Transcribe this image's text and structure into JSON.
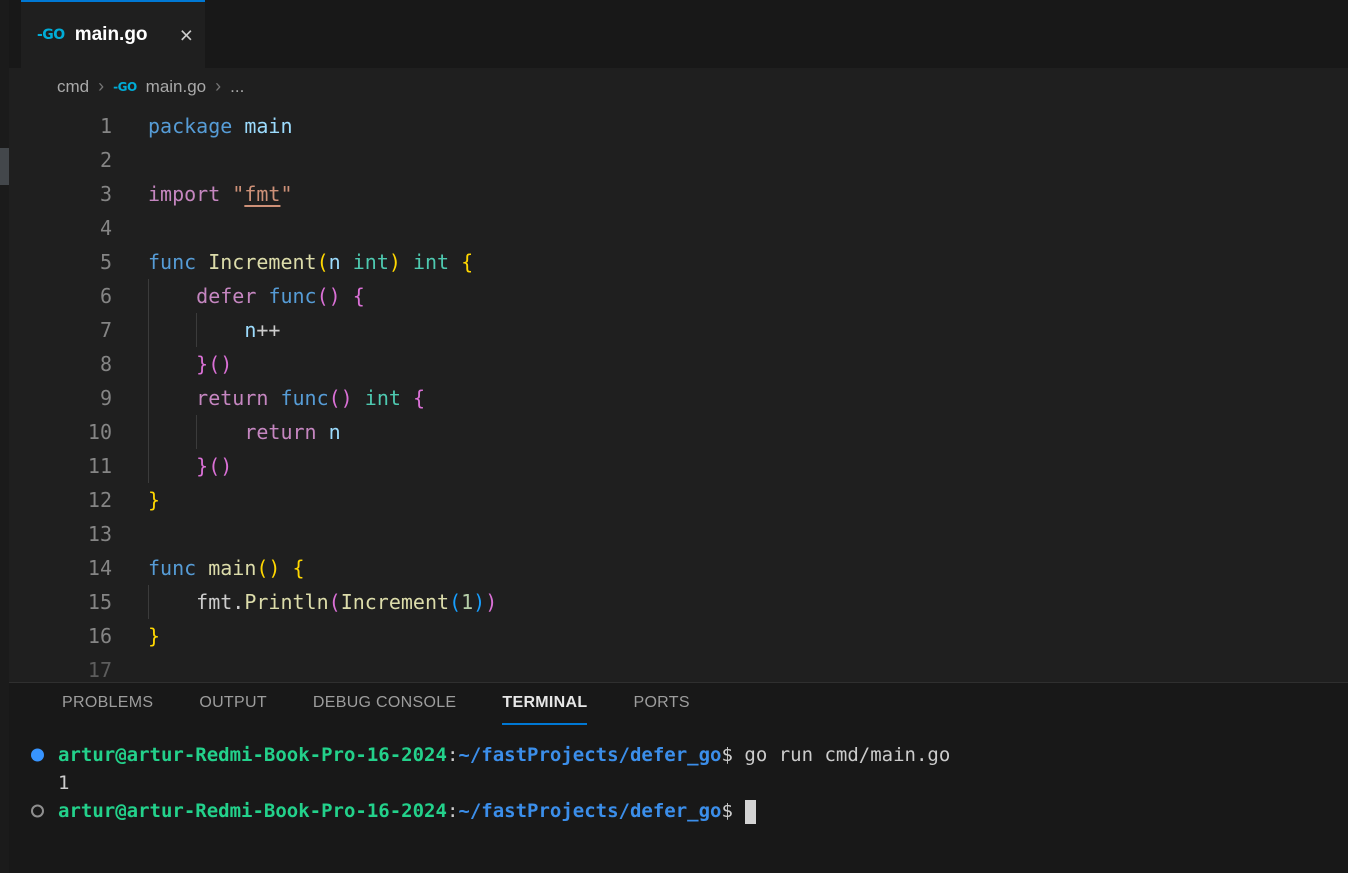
{
  "icons": {
    "go": "-GO",
    "close": "×",
    "chevron": "›"
  },
  "colors": {
    "accent": "#0078d4",
    "tab_background": "#1f1f1f",
    "editor_background": "#1f1f1f",
    "panel_background": "#181818"
  },
  "tab": {
    "label": "main.go"
  },
  "breadcrumb": {
    "items": [
      "cmd",
      "main.go",
      "..."
    ]
  },
  "editor": {
    "language": "go",
    "lines": [
      {
        "n": "1",
        "t": [
          [
            "package",
            "kw"
          ],
          [
            " ",
            "pl"
          ],
          [
            "main",
            "var"
          ]
        ]
      },
      {
        "n": "2",
        "t": []
      },
      {
        "n": "3",
        "t": [
          [
            "import",
            "ctl"
          ],
          [
            " ",
            "pl"
          ],
          [
            "\"",
            "str"
          ],
          [
            "fmt",
            "strU"
          ],
          [
            "\"",
            "str"
          ]
        ]
      },
      {
        "n": "4",
        "t": []
      },
      {
        "n": "5",
        "t": [
          [
            "func",
            "kw"
          ],
          [
            " ",
            "pl"
          ],
          [
            "Increment",
            "fn"
          ],
          [
            "(",
            "b1"
          ],
          [
            "n",
            "var"
          ],
          [
            " ",
            "pl"
          ],
          [
            "int",
            "ty"
          ],
          [
            ")",
            "b1"
          ],
          [
            " ",
            "pl"
          ],
          [
            "int",
            "ty"
          ],
          [
            " ",
            "pl"
          ],
          [
            "{",
            "b1"
          ]
        ]
      },
      {
        "n": "6",
        "t": [
          [
            "    ",
            "pl"
          ],
          [
            "defer",
            "ctl"
          ],
          [
            " ",
            "pl"
          ],
          [
            "func",
            "kw"
          ],
          [
            "()",
            "b2"
          ],
          [
            " ",
            "pl"
          ],
          [
            "{",
            "b2"
          ]
        ]
      },
      {
        "n": "7",
        "t": [
          [
            "        ",
            "pl"
          ],
          [
            "n",
            "var"
          ],
          [
            "++",
            "pl"
          ]
        ]
      },
      {
        "n": "8",
        "t": [
          [
            "    ",
            "pl"
          ],
          [
            "}()",
            "b2"
          ]
        ]
      },
      {
        "n": "9",
        "t": [
          [
            "    ",
            "pl"
          ],
          [
            "return",
            "ctl"
          ],
          [
            " ",
            "pl"
          ],
          [
            "func",
            "kw"
          ],
          [
            "()",
            "b2"
          ],
          [
            " ",
            "pl"
          ],
          [
            "int",
            "ty"
          ],
          [
            " ",
            "pl"
          ],
          [
            "{",
            "b2"
          ]
        ]
      },
      {
        "n": "10",
        "t": [
          [
            "        ",
            "pl"
          ],
          [
            "return",
            "ctl"
          ],
          [
            " ",
            "pl"
          ],
          [
            "n",
            "var"
          ]
        ]
      },
      {
        "n": "11",
        "t": [
          [
            "    ",
            "pl"
          ],
          [
            "}()",
            "b2"
          ]
        ]
      },
      {
        "n": "12",
        "t": [
          [
            "}",
            "b1"
          ]
        ]
      },
      {
        "n": "13",
        "t": []
      },
      {
        "n": "14",
        "t": [
          [
            "func",
            "kw"
          ],
          [
            " ",
            "pl"
          ],
          [
            "main",
            "fn"
          ],
          [
            "()",
            "b1"
          ],
          [
            " ",
            "pl"
          ],
          [
            "{",
            "b1"
          ]
        ]
      },
      {
        "n": "15",
        "t": [
          [
            "    ",
            "pl"
          ],
          [
            "fmt",
            "pl"
          ],
          [
            ".",
            "pl"
          ],
          [
            "Println",
            "fn"
          ],
          [
            "(",
            "b2"
          ],
          [
            "Increment",
            "fn"
          ],
          [
            "(",
            "b3"
          ],
          [
            "1",
            "num"
          ],
          [
            ")",
            "b3"
          ],
          [
            ")",
            "b2"
          ]
        ]
      },
      {
        "n": "16",
        "t": [
          [
            "}",
            "b1"
          ]
        ]
      },
      {
        "n": "17",
        "t": []
      }
    ]
  },
  "panel": {
    "tabs": [
      "PROBLEMS",
      "OUTPUT",
      "DEBUG CONSOLE",
      "TERMINAL",
      "PORTS"
    ],
    "active": "TERMINAL"
  },
  "terminal": {
    "lines": [
      {
        "deco": "filled",
        "s": [
          [
            "artur@artur-Redmi-Book-Pro-16-2024",
            "green"
          ],
          [
            ":",
            "pl"
          ],
          [
            "~/fastProjects/defer_go",
            "blue"
          ],
          [
            "$",
            "pl"
          ],
          [
            " go run cmd/main.go",
            "pl"
          ]
        ]
      },
      {
        "deco": "none",
        "s": [
          [
            "1",
            "pl"
          ]
        ]
      },
      {
        "deco": "hollow",
        "s": [
          [
            "artur@artur-Redmi-Book-Pro-16-2024",
            "green"
          ],
          [
            ":",
            "pl"
          ],
          [
            "~/fastProjects/defer_go",
            "blue"
          ],
          [
            "$ ",
            "pl"
          ]
        ],
        "cursor": true
      }
    ]
  }
}
